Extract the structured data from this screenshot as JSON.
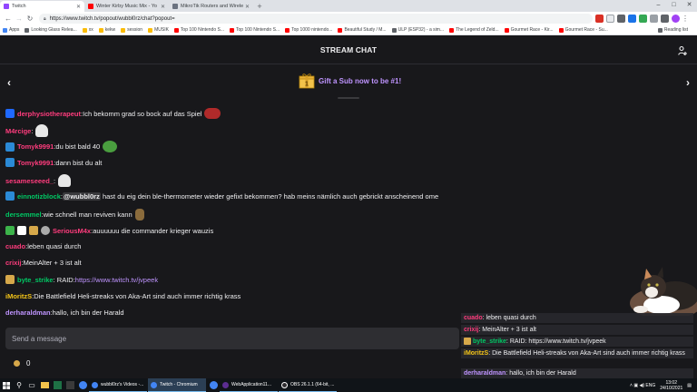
{
  "browser": {
    "tabs": [
      {
        "title": "Twitch",
        "color": "#9146ff",
        "active": true
      },
      {
        "title": "Winter Kirby Music Mix - Yo",
        "color": "#ff0000",
        "active": false
      },
      {
        "title": "MikroTik Routers and Wireless",
        "color": "#6b7280",
        "active": false
      }
    ],
    "new_tab": "+",
    "window_controls": [
      "–",
      "□",
      "✕"
    ],
    "url": "https://www.twitch.tv/popout/wubbl0rz/chat?popout=",
    "bookmarks": [
      {
        "label": "Apps",
        "color": "#4285f4"
      },
      {
        "label": "Looking Glass Relea...",
        "color": "#5f6368"
      },
      {
        "label": "xx",
        "color": "#fbbc04"
      },
      {
        "label": "kekw",
        "color": "#fbbc04"
      },
      {
        "label": "session",
        "color": "#fbbc04"
      },
      {
        "label": "MUSIK",
        "color": "#fbbc04"
      },
      {
        "label": "Top 100 Nintendo S...",
        "color": "#ff0000"
      },
      {
        "label": "Top 100 Nintendo S...",
        "color": "#ff0000"
      },
      {
        "label": "Top 1000 nintendo...",
        "color": "#ff0000"
      },
      {
        "label": "Beautiful Study / M...",
        "color": "#ff0000"
      },
      {
        "label": "ULP (ESP32) - a sim...",
        "color": "#5f6368"
      },
      {
        "label": "The Legend of Zeld...",
        "color": "#ff0000"
      },
      {
        "label": "Gourmet Race - Kir...",
        "color": "#ff0000"
      },
      {
        "label": "Gourmet Race - Su...",
        "color": "#ff0000"
      }
    ],
    "reading_list": "Reading list"
  },
  "chat": {
    "title": "STREAM CHAT",
    "gift_text": "Gift a Sub now to be #1!",
    "gift_rank": "1",
    "prev_arrow": "‹",
    "next_arrow": "›",
    "input_placeholder": "Send a message",
    "points": "0",
    "messages": [
      {
        "user": "derphysiotherapeut",
        "color": "#ff3c7d",
        "sep": ": ",
        "text": "Ich bekomm grad so bock auf das Spiel",
        "badge": "#1f69ff",
        "emote": "#b02a2a"
      },
      {
        "user": "M4rcige",
        "color": "#ff3c7d",
        "sep": ": ",
        "text": "",
        "emote": "#e8e8e8"
      },
      {
        "user": "Tomyk9991",
        "color": "#ff3c7d",
        "sep": ": ",
        "text": "du bist bald 40",
        "badge": "#2b8ad6",
        "emote": "#4a9e3f"
      },
      {
        "user": "Tomyk9991",
        "color": "#ff3c7d",
        "sep": ": ",
        "text": "dann bist du alt",
        "badge": "#2b8ad6"
      },
      {
        "user": "sesameseeed_",
        "color": "#ff3c7d",
        "sep": ": ",
        "text": "",
        "emote": "#e8e8e8"
      },
      {
        "user": "einnotizblock",
        "color": "#00c864",
        "sep": ": ",
        "text": "hast du eig dein ble-thermometer wieder gefixt bekommen? hab meins nämlich auch gebrickt anscheinend ome",
        "badge": "#2b8ad6",
        "mention": "@wubbl0rz"
      },
      {
        "user": "dersemmel",
        "color": "#00c864",
        "sep": ": ",
        "text": "wie schnell man reviven kann",
        "emote": "#8a6b3c"
      },
      {
        "user": "SeriousM4x",
        "color": "#ff3c7d",
        "sep": ": ",
        "text": "auuuuuu die commander krieger wauzis",
        "badges": [
          "#3cb34a",
          "#ffffff",
          "#d6a84a",
          "#aaaaaa"
        ]
      },
      {
        "user": "cuado",
        "color": "#ff3c7d",
        "sep": ": ",
        "text": "leben quasi durch"
      },
      {
        "user": "crixij",
        "color": "#ff3c7d",
        "sep": ": ",
        "text": "MeinAlter + 3 ist alt"
      },
      {
        "user": "byte_strike",
        "color": "#00c864",
        "sep": ": RAID: ",
        "text": "https://www.twitch.tv/jvpeek",
        "badge": "#d6a84a",
        "link": true
      },
      {
        "user": "iMoritzS",
        "color": "#f5c518",
        "sep": ": ",
        "text": "Die Battlefield Heli-streaks von Aka-Art sind auch immer richtig krass"
      },
      {
        "user": "derharaldman",
        "color": "#bf94ff",
        "sep": ": ",
        "text": "hallo, ich bin der Harald"
      }
    ]
  },
  "overlay": [
    {
      "user": "cuado",
      "color": "#ff3c7d",
      "text": "leben quasi durch"
    },
    {
      "user": "crixij",
      "color": "#ff3c7d",
      "text": "MeinAlter + 3 ist alt"
    },
    {
      "user": "byte_strike",
      "color": "#00c864",
      "text": "RAID: https://www.twitch.tv/jvpeek",
      "badge": "#d6a84a"
    },
    {
      "user": "iMoritzS",
      "color": "#f5c518",
      "text": "Die Battlefield Heli-streaks von Aka-Art sind auch immer richtig krass"
    },
    {
      "user": "derharaldman",
      "color": "#bf94ff",
      "text": "hallo, ich bin der Harald"
    }
  ],
  "taskbar": {
    "apps": [
      {
        "label": "wubbl0rz's Videos -...",
        "color": "#4285f4"
      },
      {
        "label": "Twitch - Chromium",
        "color": "#4285f4",
        "active": true
      },
      {
        "label": "WebApplication11...",
        "color": "#5c2d91"
      },
      {
        "label": "OBS 26.1.1 (64-bit, ...",
        "color": "#302e31"
      }
    ],
    "lang": "ENG",
    "time": "13:02",
    "date": "24/10/2021"
  }
}
